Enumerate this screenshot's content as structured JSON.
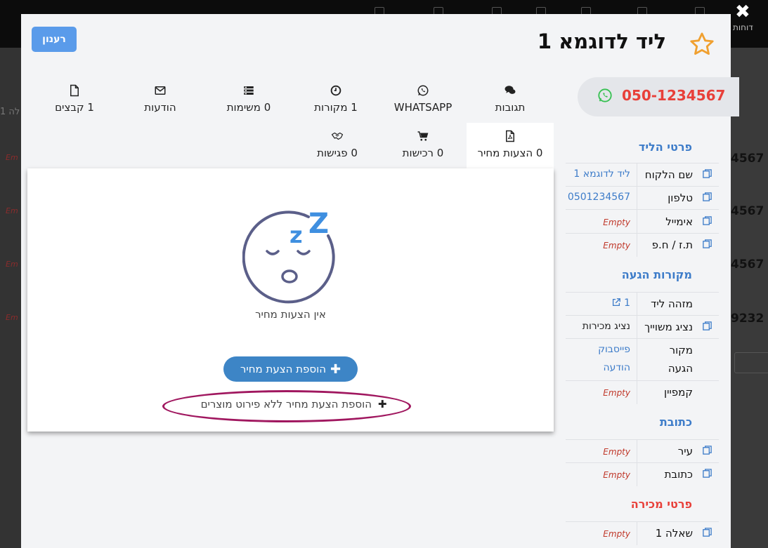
{
  "window": {
    "close_icon": "close-icon"
  },
  "background": {
    "nav_label": "דוחות",
    "left_sliver_texts": [
      "לה 1"
    ],
    "right_sliver_numbers": [
      "4567",
      "4567",
      "4567",
      "9232"
    ],
    "empty_cells": [
      "Em",
      "Em",
      "Em",
      "Em"
    ]
  },
  "header": {
    "refresh_label": "רענון",
    "title": "ליד לדוגמא 1",
    "star_icon": "star-outline-icon",
    "star_color": "#f0a030"
  },
  "phone": {
    "number": "050-1234567",
    "icon": "whatsapp-icon"
  },
  "sidebar": {
    "sections": [
      {
        "title": "פרטי הליד",
        "color": "#3d7cc9",
        "fields": [
          {
            "label": "שם הלקוח",
            "value": "ליד לדוגמא 1",
            "empty": false
          },
          {
            "label": "טלפון",
            "value": "0501234567",
            "empty": false
          },
          {
            "label": "אימייל",
            "value": "Empty",
            "empty": true
          },
          {
            "label": "ת.ז / ח.פ",
            "value": "Empty",
            "empty": true
          }
        ]
      },
      {
        "title": "מקורות הגעה",
        "color": "#3d7cc9",
        "fields": [
          {
            "label": "מזהה ליד",
            "value": "1",
            "empty": false
          },
          {
            "label": "נציג משוייך",
            "value": "נציג מכירות",
            "empty": false
          },
          {
            "label_line1": "מקור",
            "label_line2": "הגעה",
            "value_line1": "פייסבוק",
            "value_line2": "הודעה",
            "empty": false
          },
          {
            "label": "קמפיין",
            "value": "Empty",
            "empty": true
          }
        ]
      },
      {
        "title": "כתובת",
        "color": "#3d7cc9",
        "fields": [
          {
            "label": "עיר",
            "value": "Empty",
            "empty": true
          },
          {
            "label": "כתובת",
            "value": "Empty",
            "empty": true
          }
        ]
      },
      {
        "title": "פרטי מכירה",
        "color": "#e8403a",
        "fields": [
          {
            "label": "שאלה 1",
            "value": "Empty",
            "empty": true
          }
        ]
      }
    ]
  },
  "tabs": [
    {
      "label": "תגובות",
      "icon": "comments-icon"
    },
    {
      "label": "WHATSAPP",
      "icon": "whatsapp-icon"
    },
    {
      "label": "1 מקורות",
      "icon": "clock-icon"
    },
    {
      "label": "0 משימות",
      "icon": "tasks-icon"
    },
    {
      "label": "הודעות",
      "icon": "envelope-icon"
    },
    {
      "label": "1 קבצים",
      "icon": "file-icon"
    },
    {
      "label": "0 הצעות מחיר",
      "icon": "pdf-file-icon",
      "active": true
    },
    {
      "label": "0 רכישות",
      "icon": "cart-icon"
    },
    {
      "label": "0 פגישות",
      "icon": "handshake-icon"
    }
  ],
  "panel": {
    "illustration": "sleeping-face-icon",
    "empty_message": "אין הצעות מחיר",
    "add_button_label": "הוספת הצעת מחיר",
    "add_link_label": "הוספת הצעת מחיר ללא פירוט מוצרים",
    "highlight_color": "#a0175f"
  }
}
